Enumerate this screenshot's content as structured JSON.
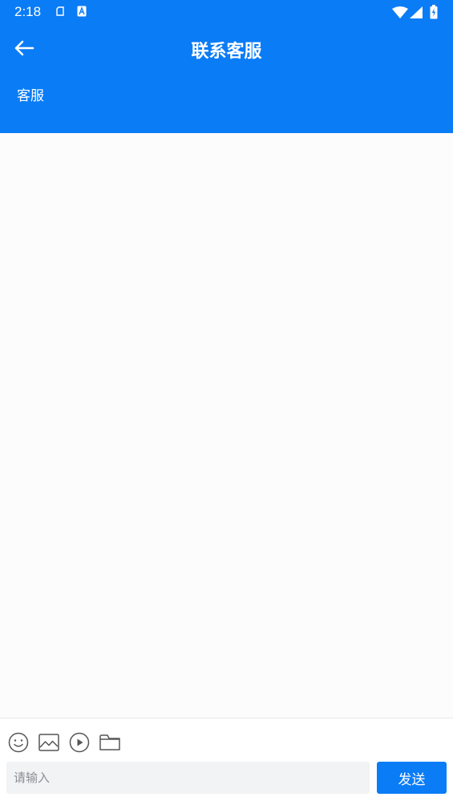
{
  "status_bar": {
    "time": "2:18"
  },
  "header": {
    "title": "联系客服",
    "subtitle": "客服",
    "back_icon": "arrow-left-icon"
  },
  "composer": {
    "tools": [
      "emoji-icon",
      "image-icon",
      "video-icon",
      "folder-icon"
    ],
    "input_placeholder": "请输入",
    "input_value": "",
    "send_label": "发送"
  },
  "colors": {
    "primary": "#0a7cf6",
    "background": "#fcfcfd",
    "input_background": "#f2f3f5"
  }
}
